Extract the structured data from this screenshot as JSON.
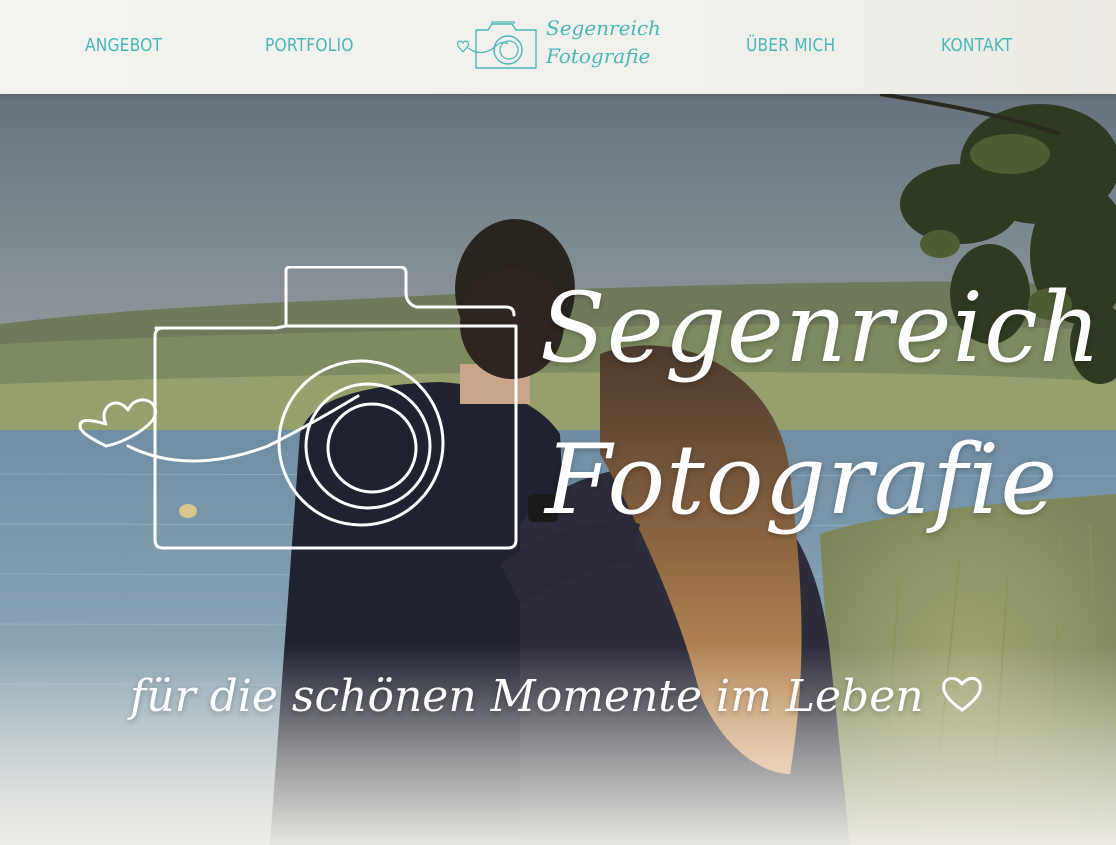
{
  "nav": {
    "angebot": "ANGEBOT",
    "portfolio": "PORTFOLIO",
    "ueber_mich": "ÜBER MICH",
    "kontakt": "KONTAKT"
  },
  "logo": {
    "line1": "Segenreich",
    "line2": "Fotografie"
  },
  "hero": {
    "title_line1": "Segenreich",
    "title_line2": "Fotografie",
    "tagline": "für die schönen Momente im Leben"
  },
  "icons": {
    "logo": "camera-heart-icon",
    "tagline": "heart-outline-icon"
  },
  "colors": {
    "accent": "#4bb8b8",
    "header_bg": "#f2f1ed",
    "hero_text": "#ffffff"
  }
}
